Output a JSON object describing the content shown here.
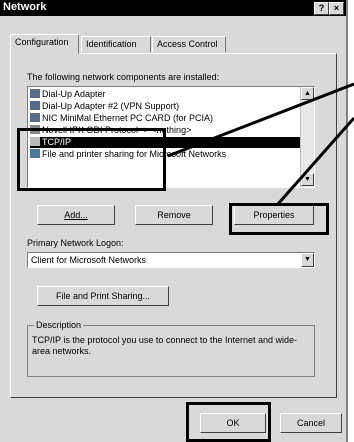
{
  "window": {
    "title": "Network",
    "help_label": "?",
    "close_label": "×"
  },
  "tabs": [
    {
      "label": "Configuration"
    },
    {
      "label": "Identification"
    },
    {
      "label": "Access Control"
    }
  ],
  "components": {
    "heading": "The following network components are installed:",
    "items": [
      {
        "label": "Dial-Up Adapter",
        "icon": "adapter-icon"
      },
      {
        "label": "Dial-Up Adapter #2 (VPN Support)",
        "icon": "adapter-icon"
      },
      {
        "label": "NIC MiniMal Ethernet PC CARD (for PCIA)",
        "icon": "adapter-icon"
      },
      {
        "label": "Novell IPX ODI Protocol -> <nothing>",
        "icon": "protocol-icon"
      },
      {
        "label": "TCP/IP",
        "icon": "protocol-icon",
        "selected": true
      },
      {
        "label": "File and printer sharing for Microsoft Networks",
        "icon": "service-icon"
      }
    ]
  },
  "buttons": {
    "add": "Add...",
    "remove": "Remove",
    "properties": "Properties",
    "file_print_sharing": "File and Print Sharing...",
    "ok": "OK",
    "cancel": "Cancel"
  },
  "logon": {
    "label": "Primary Network Logon:",
    "value": "Client for Microsoft Networks"
  },
  "description": {
    "caption": "Description",
    "text": "TCP/IP is the protocol you use to connect to the Internet and wide-area networks."
  },
  "colors": {
    "dialog_bg": "#d9d9d9",
    "titlebar_bg": "#000000",
    "selection_bg": "#000000",
    "callout": "#000000"
  }
}
